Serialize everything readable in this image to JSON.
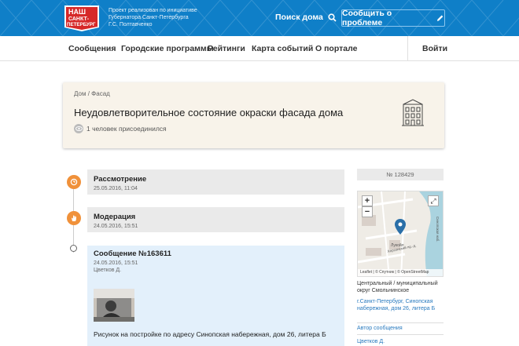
{
  "header": {
    "logo_text": [
      "НАШ",
      "САНКТ-",
      "ПЕТЕРБУРГ"
    ],
    "tagline": [
      "Проект реализован по инициативе",
      "Губернатора Санкт-Петербурга",
      "Г.С. Полтавченко"
    ],
    "search_label": "Поиск дома",
    "report_label": "Сообщить о проблеме",
    "brand_color": "#0f7fc8"
  },
  "nav": {
    "items": [
      "Сообщения",
      "Городские программы",
      "Рейтинги",
      "Карта событий",
      "О портале"
    ],
    "login": "Войти"
  },
  "problem": {
    "breadcrumb": [
      "Дом",
      "Фасад"
    ],
    "breadcrumb_sep": "/",
    "title": "Неудовлетворительное состояние окраски фасада дома",
    "joined": "1 человек присоединился"
  },
  "timeline": {
    "steps": [
      {
        "title": "Рассмотрение",
        "date": "25.05.2016, 11:04",
        "color": "#f0913a"
      },
      {
        "title": "Модерация",
        "date": "24.05.2016, 15:51",
        "color": "#f0913a"
      }
    ],
    "message": {
      "title": "Сообщение №163611",
      "date": "24.05.2016, 15:51",
      "author": "Цветков Д.",
      "text": "Рисунок на постройке по адресу Синопская набережная, дом 26, литера Б"
    }
  },
  "sidebar": {
    "number": "№ 128429",
    "map": {
      "zoom_in": "+",
      "zoom_out": "−",
      "attribution": "Leaflet | © Спутник | © OpenStreetMap",
      "street_labels": [
        "Лукойл",
        "Херсонский пр.-д.",
        "Синопская наб."
      ]
    },
    "district": "Центральный / муниципальный округ Смольнинское",
    "address": "г.Санкт-Петербург, Синопская набережная, дом 26, литера Б",
    "author_label": "Автор сообщения",
    "author_name": "Цветков Д."
  }
}
